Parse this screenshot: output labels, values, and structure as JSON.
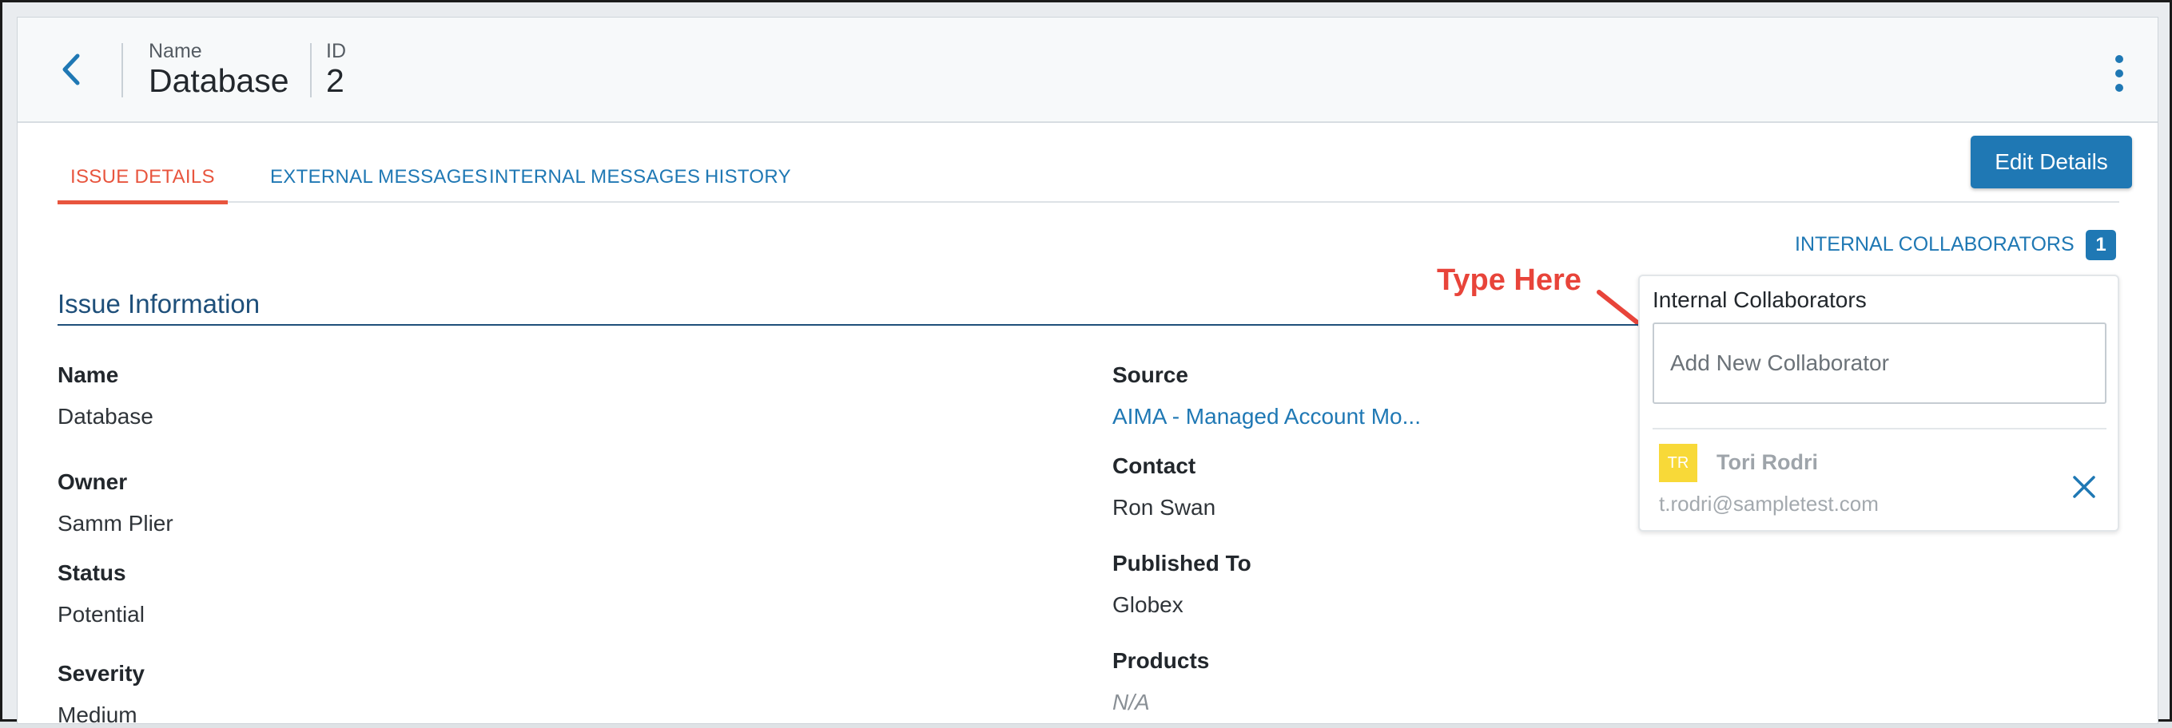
{
  "header": {
    "name_label": "Name",
    "name_value": "Database",
    "id_label": "ID",
    "id_value": "2"
  },
  "tabs": [
    {
      "label": "ISSUE DETAILS",
      "active": true
    },
    {
      "label": "EXTERNAL MESSAGES",
      "active": false
    },
    {
      "label": "INTERNAL MESSAGES",
      "active": false
    },
    {
      "label": "HISTORY",
      "active": false
    }
  ],
  "edit_button": "Edit Details",
  "collaborators_link": {
    "label": "INTERNAL COLLABORATORS",
    "count": "1"
  },
  "annotation": {
    "text": "Type Here"
  },
  "section": {
    "title": "Issue Information"
  },
  "left_fields": [
    {
      "label": "Name",
      "value": "Database"
    },
    {
      "label": "Owner",
      "value": "Samm Plier"
    },
    {
      "label": "Status",
      "value": "Potential"
    },
    {
      "label": "Severity",
      "value": "Medium"
    }
  ],
  "right_fields": [
    {
      "label": "Source",
      "value": "AIMA - Managed Account Mo..."
    },
    {
      "label": "Contact",
      "value": "Ron Swan"
    },
    {
      "label": "Published To",
      "value": "Globex"
    },
    {
      "label": "Products",
      "value": "N/A"
    }
  ],
  "popover": {
    "title": "Internal Collaborators",
    "input_placeholder": "Add New Collaborator",
    "input_value": "",
    "collaborators": [
      {
        "initials": "TR",
        "name": "Tori Rodri",
        "email": "t.rodri@sampletest.com"
      }
    ]
  },
  "colors": {
    "accent": "#1f78b4",
    "active_tab": "#e8553e",
    "annotation": "#e8443a",
    "avatar": "#f8d938",
    "section_title": "#1e4f7a"
  },
  "icons": {
    "back": "chevron-left-icon",
    "menu": "kebab-menu-icon",
    "remove": "close-icon",
    "annotation": "arrow-icon"
  }
}
